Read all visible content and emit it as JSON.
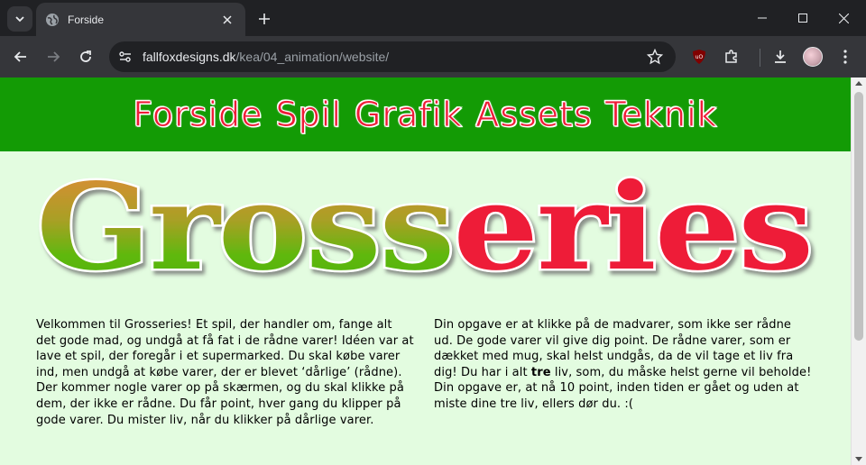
{
  "browser": {
    "tab_title": "Forside",
    "url_host": "fallfoxdesigns.dk",
    "url_path": "/kea/04_animation/website/"
  },
  "nav": {
    "items": [
      "Forside",
      "Spil",
      "Grafik",
      "Assets",
      "Teknik"
    ]
  },
  "logo": {
    "part1": "Gross",
    "part2": "eries"
  },
  "content": {
    "left_paragraph": "Velkommen til Grosseries! Et spil, der handler om, fange alt det gode mad, og undgå at få fat i de rådne varer! Idéen var at lave et spil, der foregår i et supermarked. Du skal købe varer ind, men undgå at købe varer, der er blevet ‘dårlige’ (rådne). Der kommer nogle varer op på skærmen, og du skal klikke på dem, der ikke er rådne. Du får point, hver gang du klipper på gode varer. Du mister liv, når du klikker på dårlige varer.",
    "right_before": "Din opgave er at klikke på de madvarer, som ikke ser rådne ud. De gode varer vil give dig point. De rådne varer, som er dækket med mug, skal helst undgås, da de vil tage et liv fra dig! Du har i alt ",
    "right_bold": "tre",
    "right_after": " liv, som, du måske helst gerne vil beholde! Din opgave er, at nå 10 point, inden tiden er gået og uden at miste dine tre liv, ellers dør du. :("
  },
  "colors": {
    "nav_bg": "#139b05",
    "page_bg": "#e3fce0",
    "accent_red": "#ee1c37",
    "logo_green": "#5fb80e",
    "logo_orange": "#e8873a"
  }
}
